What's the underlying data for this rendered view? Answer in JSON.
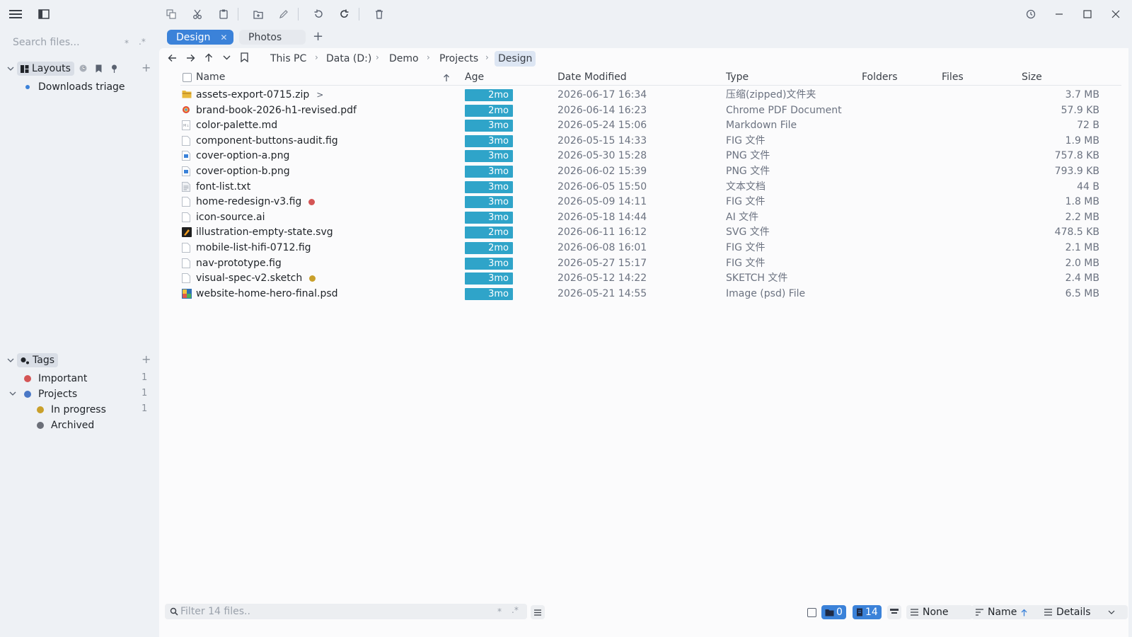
{
  "sidebar": {
    "search_placeholder": "Search files...",
    "search_star": "*",
    "search_regex": ".*",
    "layouts": {
      "label": "Layouts",
      "items": [
        {
          "label": "Downloads triage",
          "color": "#3b82d9"
        }
      ]
    },
    "tags": {
      "label": "Tags",
      "items": [
        {
          "label": "Important",
          "color": "#d45555",
          "count": "1"
        },
        {
          "label": "Projects",
          "color": "#4a78c6",
          "count": "1"
        },
        {
          "label": "In progress",
          "color": "#c9a02b",
          "count": "1"
        },
        {
          "label": "Archived",
          "color": "#6b6f78",
          "count": ""
        }
      ]
    }
  },
  "tabs": [
    {
      "label": "Design",
      "active": true
    },
    {
      "label": "Photos",
      "active": false
    }
  ],
  "breadcrumb": [
    "This PC",
    "Data (D:)",
    "Demo",
    "Projects",
    "Design"
  ],
  "columns": {
    "name": "Name",
    "age": "Age",
    "date": "Date Modified",
    "type": "Type",
    "folders": "Folders",
    "files": "Files",
    "size": "Size"
  },
  "files": [
    {
      "name": "assets-export-0715.zip",
      "age": "2mo",
      "date": "2026-06-17 16:34",
      "type": "压缩(zipped)文件夹",
      "size": "3.7 MB",
      "icon": "zip-icon",
      "tag": "",
      "expand": ">"
    },
    {
      "name": "brand-book-2026-h1-revised.pdf",
      "age": "2mo",
      "date": "2026-06-14 16:23",
      "type": "Chrome PDF Document",
      "size": "57.9 KB",
      "icon": "pdf-icon",
      "tag": ""
    },
    {
      "name": "color-palette.md",
      "age": "3mo",
      "date": "2026-05-24 15:06",
      "type": "Markdown File",
      "size": "72 B",
      "icon": "markdown-icon",
      "tag": ""
    },
    {
      "name": "component-buttons-audit.fig",
      "age": "3mo",
      "date": "2026-05-15 14:33",
      "type": "FIG 文件",
      "size": "1.9 MB",
      "icon": "file-icon",
      "tag": ""
    },
    {
      "name": "cover-option-a.png",
      "age": "3mo",
      "date": "2026-05-30 15:28",
      "type": "PNG 文件",
      "size": "757.8 KB",
      "icon": "image-icon",
      "tag": ""
    },
    {
      "name": "cover-option-b.png",
      "age": "3mo",
      "date": "2026-06-02 15:39",
      "type": "PNG 文件",
      "size": "793.9 KB",
      "icon": "image-icon",
      "tag": ""
    },
    {
      "name": "font-list.txt",
      "age": "3mo",
      "date": "2026-06-05 15:50",
      "type": "文本文档",
      "size": "44 B",
      "icon": "text-file-icon",
      "tag": ""
    },
    {
      "name": "home-redesign-v3.fig",
      "age": "3mo",
      "date": "2026-05-09 14:11",
      "type": "FIG 文件",
      "size": "1.8 MB",
      "icon": "file-icon",
      "tag": "#d45555"
    },
    {
      "name": "icon-source.ai",
      "age": "3mo",
      "date": "2026-05-18 14:44",
      "type": "AI 文件",
      "size": "2.2 MB",
      "icon": "file-icon",
      "tag": ""
    },
    {
      "name": "illustration-empty-state.svg",
      "age": "2mo",
      "date": "2026-06-11 16:12",
      "type": "SVG 文件",
      "size": "478.5 KB",
      "icon": "svg-icon",
      "tag": ""
    },
    {
      "name": "mobile-list-hifi-0712.fig",
      "age": "2mo",
      "date": "2026-06-08 16:01",
      "type": "FIG 文件",
      "size": "2.1 MB",
      "icon": "file-icon",
      "tag": ""
    },
    {
      "name": "nav-prototype.fig",
      "age": "3mo",
      "date": "2026-05-27 15:17",
      "type": "FIG 文件",
      "size": "2.0 MB",
      "icon": "file-icon",
      "tag": ""
    },
    {
      "name": "visual-spec-v2.sketch",
      "age": "3mo",
      "date": "2026-05-12 14:22",
      "type": "SKETCH 文件",
      "size": "2.4 MB",
      "icon": "file-icon",
      "tag": "#c9a02b"
    },
    {
      "name": "website-home-hero-final.psd",
      "age": "3mo",
      "date": "2026-05-21 14:55",
      "type": "Image (psd) File",
      "size": "6.5 MB",
      "icon": "psd-icon",
      "tag": ""
    }
  ],
  "statusbar": {
    "filter_placeholder": "Filter 14 files..",
    "filter_star": "*",
    "filter_regex": ".*",
    "folders_count": "0",
    "files_count": "14",
    "group_label": "None",
    "sort_label": "Name",
    "view_label": "Details"
  },
  "colors": {
    "accent": "#3b82d9",
    "age_badge": "#2fa4c9"
  }
}
